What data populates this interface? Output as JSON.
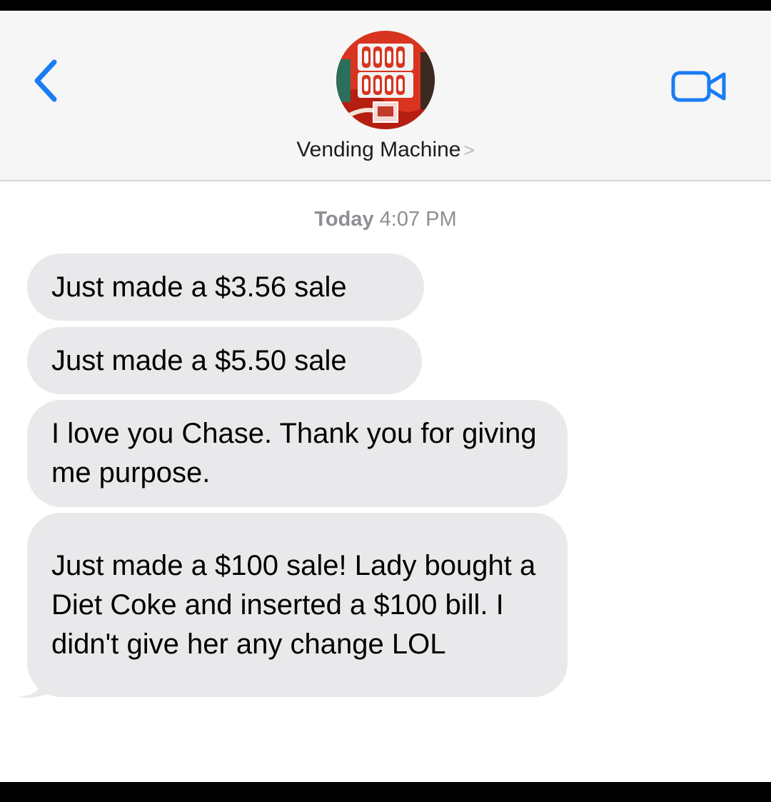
{
  "header": {
    "back_icon": "chevron-left-icon",
    "contact_name": "Vending Machine",
    "contact_chevron": ">",
    "video_icon": "video-camera-icon",
    "accent_color": "#1a7cf5"
  },
  "conversation": {
    "timestamp_day": "Today",
    "timestamp_time": "4:07 PM",
    "messages": [
      {
        "text": "Just made a $3.56 sale"
      },
      {
        "text": "Just made a $5.50 sale"
      },
      {
        "text": "I love you Chase. Thank you for giving me purpose."
      },
      {
        "text": "Just made a $100 sale! Lady bought a Diet Coke and inserted a $100 bill. I didn't give her any change LOL"
      }
    ]
  },
  "colors": {
    "incoming_bubble": "#e9e9eb",
    "header_bg": "#f6f6f6",
    "timestamp": "#8e8e93"
  }
}
